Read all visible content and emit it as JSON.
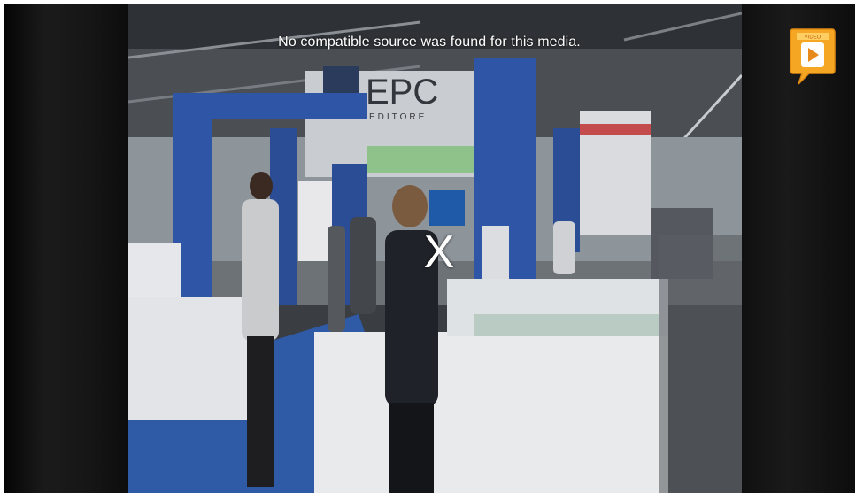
{
  "player": {
    "error_message": "No compatible source was found for this media.",
    "close_label": "X",
    "badge_text": "VIDEO"
  },
  "poster": {
    "booth_sign": "EPC",
    "booth_subsign": "EDITORE"
  },
  "colors": {
    "logo_orange": "#f5a623",
    "booth_blue": "#2f56a6"
  }
}
